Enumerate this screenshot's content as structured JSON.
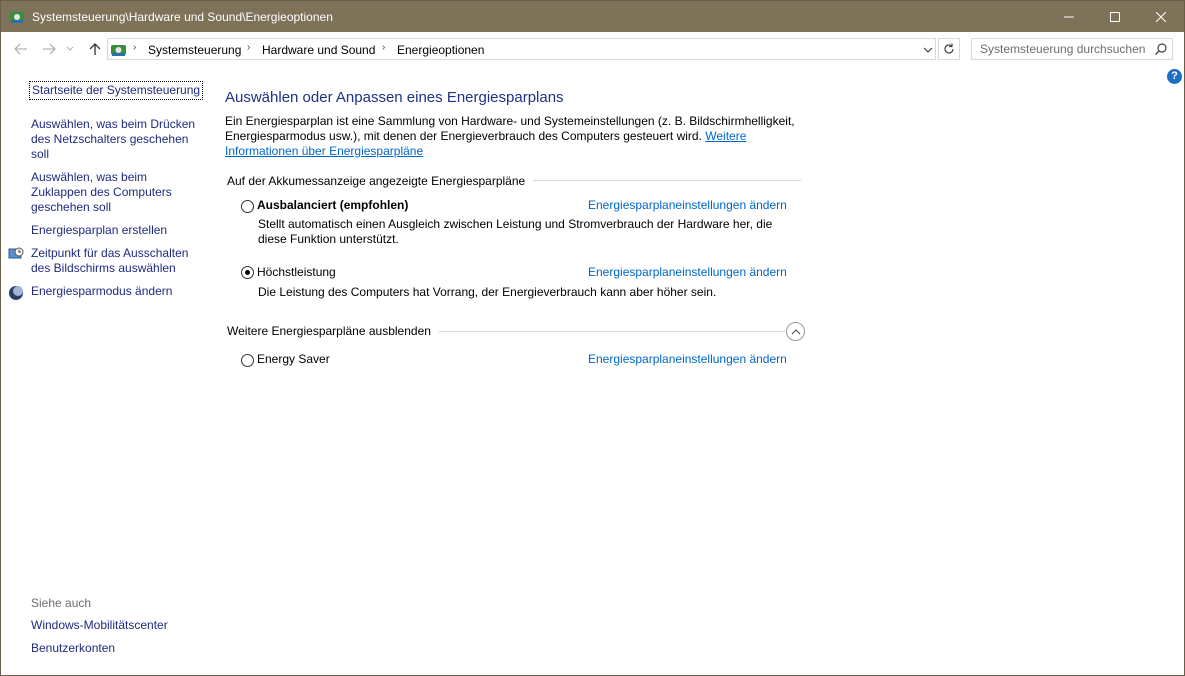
{
  "window": {
    "title": "Systemsteuerung\\Hardware und Sound\\Energieoptionen",
    "controls": [
      "minimize",
      "maximize",
      "close"
    ]
  },
  "addressbar": {
    "breadcrumbs": [
      "Systemsteuerung",
      "Hardware und Sound",
      "Energieoptionen"
    ],
    "search_placeholder": "Systemsteuerung durchsuchen"
  },
  "sidebar": {
    "home": "Startseite der Systemsteuerung",
    "links": [
      "Auswählen, was beim Drücken des Netzschalters geschehen soll",
      "Auswählen, was beim Zuklappen des Computers geschehen soll",
      "Energiesparplan erstellen",
      "Zeitpunkt für das Ausschalten des Bildschirms auswählen",
      "Energiesparmodus ändern"
    ],
    "see_also_heading": "Siehe auch",
    "see_also": [
      "Windows-Mobilitätscenter",
      "Benutzerkonten"
    ]
  },
  "main": {
    "title": "Auswählen oder Anpassen eines Energiesparplans",
    "intro": "Ein Energiesparplan ist eine Sammlung von Hardware- und Systemeinstellungen (z. B. Bildschirmhelligkeit, Energiesparmodus usw.), mit denen der Energieverbrauch des Computers gesteuert wird.",
    "intro_link": "Weitere Informationen über Energiesparpläne",
    "group1_label": "Auf der Akkumessanzeige angezeigte Energiesparpläne",
    "group2_label": "Weitere Energiesparpläne ausblenden",
    "plan_link_label": "Energiesparplaneinstellungen ändern",
    "plans": [
      {
        "name": "Ausbalanciert (empfohlen)",
        "description": "Stellt automatisch einen Ausgleich zwischen Leistung und Stromverbrauch der Hardware her, die diese Funktion unterstützt.",
        "selected": false
      },
      {
        "name": "Höchstleistung",
        "description": "Die Leistung des Computers hat Vorrang, der Energieverbrauch kann aber höher sein.",
        "selected": true
      },
      {
        "name": "Energy Saver",
        "description": "",
        "selected": false
      }
    ]
  },
  "colors": {
    "titlebar": "#7e7258",
    "link": "#0066cc",
    "nav_link": "#1f2a80",
    "heading": "#1e3287"
  }
}
